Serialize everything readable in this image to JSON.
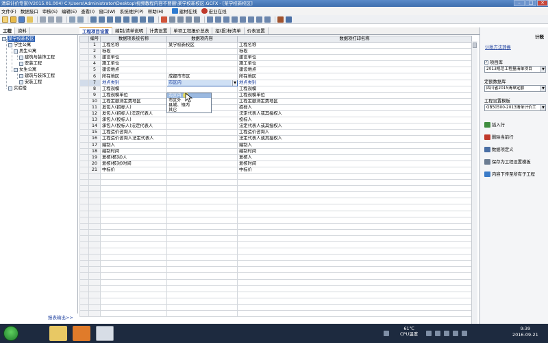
{
  "window": {
    "title": "清单计价专家(V2015.01.004) C:\\Users\\Administrator\\Desktop\\视频教程内容不要删\\某学校新校区.GCFX - [某学校新校区]",
    "controls": [
      "–",
      "□",
      "×"
    ]
  },
  "menu": {
    "items": [
      "文件(F)",
      "数据接口",
      "审核(S)",
      "编辑(E)",
      "查看(I)",
      "窗口(W)",
      "系统维护(P)",
      "帮助(H)"
    ],
    "tool_links": [
      "建材在线",
      "宏业在线"
    ]
  },
  "left_tabs": [
    "工程",
    "资料"
  ],
  "tree": [
    {
      "label": "某学校新校区",
      "level": 0,
      "selected": true
    },
    {
      "label": "学生公寓",
      "level": 1
    },
    {
      "label": "男生公寓",
      "level": 2
    },
    {
      "label": "建筑与装饰工程",
      "level": 3
    },
    {
      "label": "安装工程",
      "level": 3
    },
    {
      "label": "女生公寓",
      "level": 2
    },
    {
      "label": "建筑与装饰工程",
      "level": 3
    },
    {
      "label": "安装工程",
      "level": 3
    },
    {
      "label": "实验楼",
      "level": 1
    }
  ],
  "report_link": "报表输出>>",
  "main_tabs": [
    "工程项目设置",
    "编制/清单说明",
    "计费设置",
    "单项工程报价总表",
    "招(投)标清单",
    "价表设置"
  ],
  "grid": {
    "headers": [
      "编号",
      "数据项系统名称",
      "数据项内容",
      "数据项打印名称"
    ],
    "rows": [
      {
        "no": "1",
        "name": "工程名称",
        "content": "某学校新校区",
        "print": "工程名称"
      },
      {
        "no": "2",
        "name": "标段",
        "content": "",
        "print": "标段"
      },
      {
        "no": "3",
        "name": "建设单位",
        "content": "",
        "print": "建设单位"
      },
      {
        "no": "4",
        "name": "施工单位",
        "content": "",
        "print": "施工单位"
      },
      {
        "no": "5",
        "name": "建设地点",
        "content": "",
        "print": "建设地点"
      },
      {
        "no": "6",
        "name": "所在地区",
        "content": "成都市市区",
        "print": "所在地区"
      },
      {
        "no": "7",
        "name": "地点类别",
        "content": "市区内",
        "print": "地点类别"
      },
      {
        "no": "8",
        "name": "工程规模",
        "content": "",
        "print": "工程规模"
      },
      {
        "no": "9",
        "name": "工程规模单位",
        "content": "",
        "print": "工程规模单位"
      },
      {
        "no": "10",
        "name": "工程定额测定费地区",
        "content": "",
        "print": "工程定额测定费地区"
      },
      {
        "no": "11",
        "name": "发包人(招标人)",
        "content": "",
        "print": "招标人"
      },
      {
        "no": "12",
        "name": "发包人(招标人)法定代表人",
        "content": "",
        "print": "法定代表人或其授权人"
      },
      {
        "no": "13",
        "name": "承包人(投标人)",
        "content": "",
        "print": "投标人"
      },
      {
        "no": "14",
        "name": "承包人(投标人)法定代表人",
        "content": "",
        "print": "法定代表人或其授权人"
      },
      {
        "no": "15",
        "name": "工程造价咨询人",
        "content": "",
        "print": "工程造价咨询人"
      },
      {
        "no": "16",
        "name": "工程造价咨询人法定代表人",
        "content": "",
        "print": "法定代表人或其授权人"
      },
      {
        "no": "17",
        "name": "编制人",
        "content": "",
        "print": "编制人"
      },
      {
        "no": "18",
        "name": "编制时间",
        "content": "",
        "print": "编制时间"
      },
      {
        "no": "19",
        "name": "复核(核对)人",
        "content": "",
        "print": "复核人"
      },
      {
        "no": "20",
        "name": "复核(核对)时间",
        "content": "",
        "print": "复核时间"
      },
      {
        "no": "21",
        "name": "中标价",
        "content": "",
        "print": "中标价"
      }
    ]
  },
  "dropdown": {
    "options": [
      "市区内",
      "市区外",
      "县城、镇内",
      "其它"
    ],
    "highlighted": 0
  },
  "right_panel": {
    "title": "计税",
    "method_link": "计税方法转换",
    "item_library_label": "项目库",
    "item_library_value": "2013规范工程量清单项目",
    "quota_db_label": "定额数据库",
    "quota_db_value": "四川省2015清单定额",
    "template_label": "工程设置模板",
    "template_value": "GB50500-2013清单计价工",
    "actions": [
      "插入行",
      "删除当前行",
      "数据项定义",
      "保存为工程设置模板",
      "内容下传至所有子工程"
    ]
  },
  "taskbar": {
    "temp_value": "61℃",
    "temp_label": "CPU温度",
    "time": "9:39",
    "date": "2016-09-21"
  }
}
